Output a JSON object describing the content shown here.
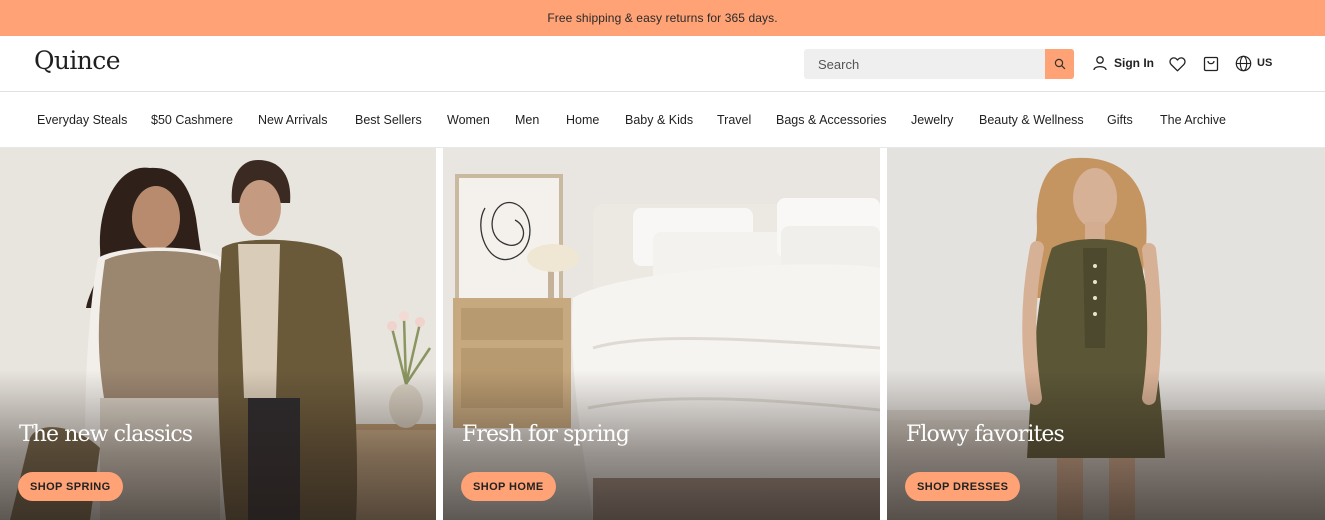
{
  "promo": {
    "text": "Free shipping & easy returns for 365 days."
  },
  "header": {
    "logo": "Quince",
    "search_placeholder": "Search",
    "sign_in": "Sign In",
    "region": "US"
  },
  "nav": {
    "items": [
      {
        "label": "Everyday Steals"
      },
      {
        "label": "$50 Cashmere"
      },
      {
        "label": "New Arrivals"
      },
      {
        "label": "Best Sellers"
      },
      {
        "label": "Women"
      },
      {
        "label": "Men"
      },
      {
        "label": "Home"
      },
      {
        "label": "Baby & Kids"
      },
      {
        "label": "Travel"
      },
      {
        "label": "Bags & Accessories"
      },
      {
        "label": "Jewelry"
      },
      {
        "label": "Beauty & Wellness"
      },
      {
        "label": "Gifts"
      },
      {
        "label": "The Archive"
      }
    ]
  },
  "tiles": [
    {
      "title": "The new classics",
      "cta": "SHOP SPRING"
    },
    {
      "title": "Fresh for spring",
      "cta": "SHOP HOME"
    },
    {
      "title": "Flowy favorites",
      "cta": "SHOP DRESSES"
    }
  ],
  "colors": {
    "accent": "#ffa275",
    "text": "#222222"
  },
  "icons": [
    "search-icon",
    "user-icon",
    "heart-icon",
    "cart-icon",
    "globe-icon"
  ]
}
